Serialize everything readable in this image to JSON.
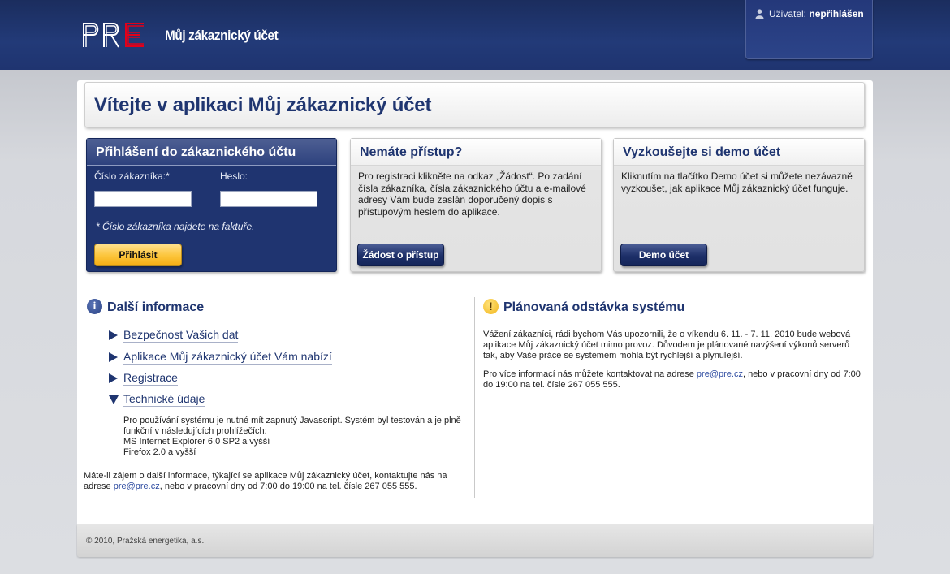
{
  "header": {
    "logo_text": "PRE",
    "app_title": "Můj zákaznický účet",
    "user_label": "Uživatel:",
    "user_status": "nepřihlášen"
  },
  "welcome": {
    "title": "Vítejte v aplikaci Můj zákaznický účet"
  },
  "login": {
    "title": "Přihlášení do zákaznického účtu",
    "customer_label": "Číslo zákazníka:*",
    "password_label": "Heslo:",
    "customer_value": "",
    "password_value": "",
    "hint": "* Číslo zákazníka najdete na faktuře.",
    "submit_label": "Přihlásit"
  },
  "access": {
    "title": "Nemáte přístup?",
    "text": "Pro registraci klikněte na odkaz „Žádost“. Po zadání čísla zákazníka, čísla zákaznického účtu a e-mailové adresy Vám bude zaslán doporučený dopis s přístupovým heslem do aplikace.",
    "button_label": "Žádost o přístup"
  },
  "demo": {
    "title": "Vyzkoušejte si demo účet",
    "text": "Kliknutím na tlačítko Demo účet si můžete nezávazně vyzkoušet, jak aplikace Můj zákaznický účet funguje.",
    "button_label": "Demo účet"
  },
  "more_info": {
    "title": "Další informace",
    "links": [
      "Bezpečnost Vašich dat",
      "Aplikace Můj zákaznický účet Vám nabízí",
      "Registrace",
      "Technické údaje"
    ],
    "tech_lines": [
      "Pro používání systému je nutné mít zapnutý Javascript. Systém byl testován a je plně funkční v následujících prohlížečích:",
      "MS Internet Explorer 6.0 SP2 a vyšší",
      "Firefox 2.0 a vyšší"
    ],
    "contact_before": "Máte-li zájem o další informace, týkající se aplikace Můj zákaznický účet, kontaktujte nás na adrese ",
    "contact_email": "pre@pre.cz",
    "contact_after": ", nebo v pracovní dny od 7:00 do 19:00 na tel. čísle 267 055 555."
  },
  "outage": {
    "title": "Plánovaná odstávka systému",
    "paragraph1": "Vážení zákazníci, rádi bychom Vás upozornili, že o víkendu 6. 11. - 7. 11. 2010 bude webová aplikace Můj zákaznický účet mimo provoz. Důvodem je plánované navýšení výkonů serverů tak, aby Vaše práce se systémem mohla být rychlejší a plynulejší.",
    "p2_before": "Pro více informací nás můžete kontaktovat na adrese ",
    "p2_email": "pre@pre.cz",
    "p2_after": ", nebo v pracovní dny od 7:00 do 19:00 na tel. čísle 267 055 555."
  },
  "footer": {
    "copyright": "© 2010, Pražská energetika, a.s."
  },
  "colors": {
    "brand_blue": "#1f3470",
    "logo_red": "#e2001a",
    "button_yellow": "#fcc43a"
  }
}
